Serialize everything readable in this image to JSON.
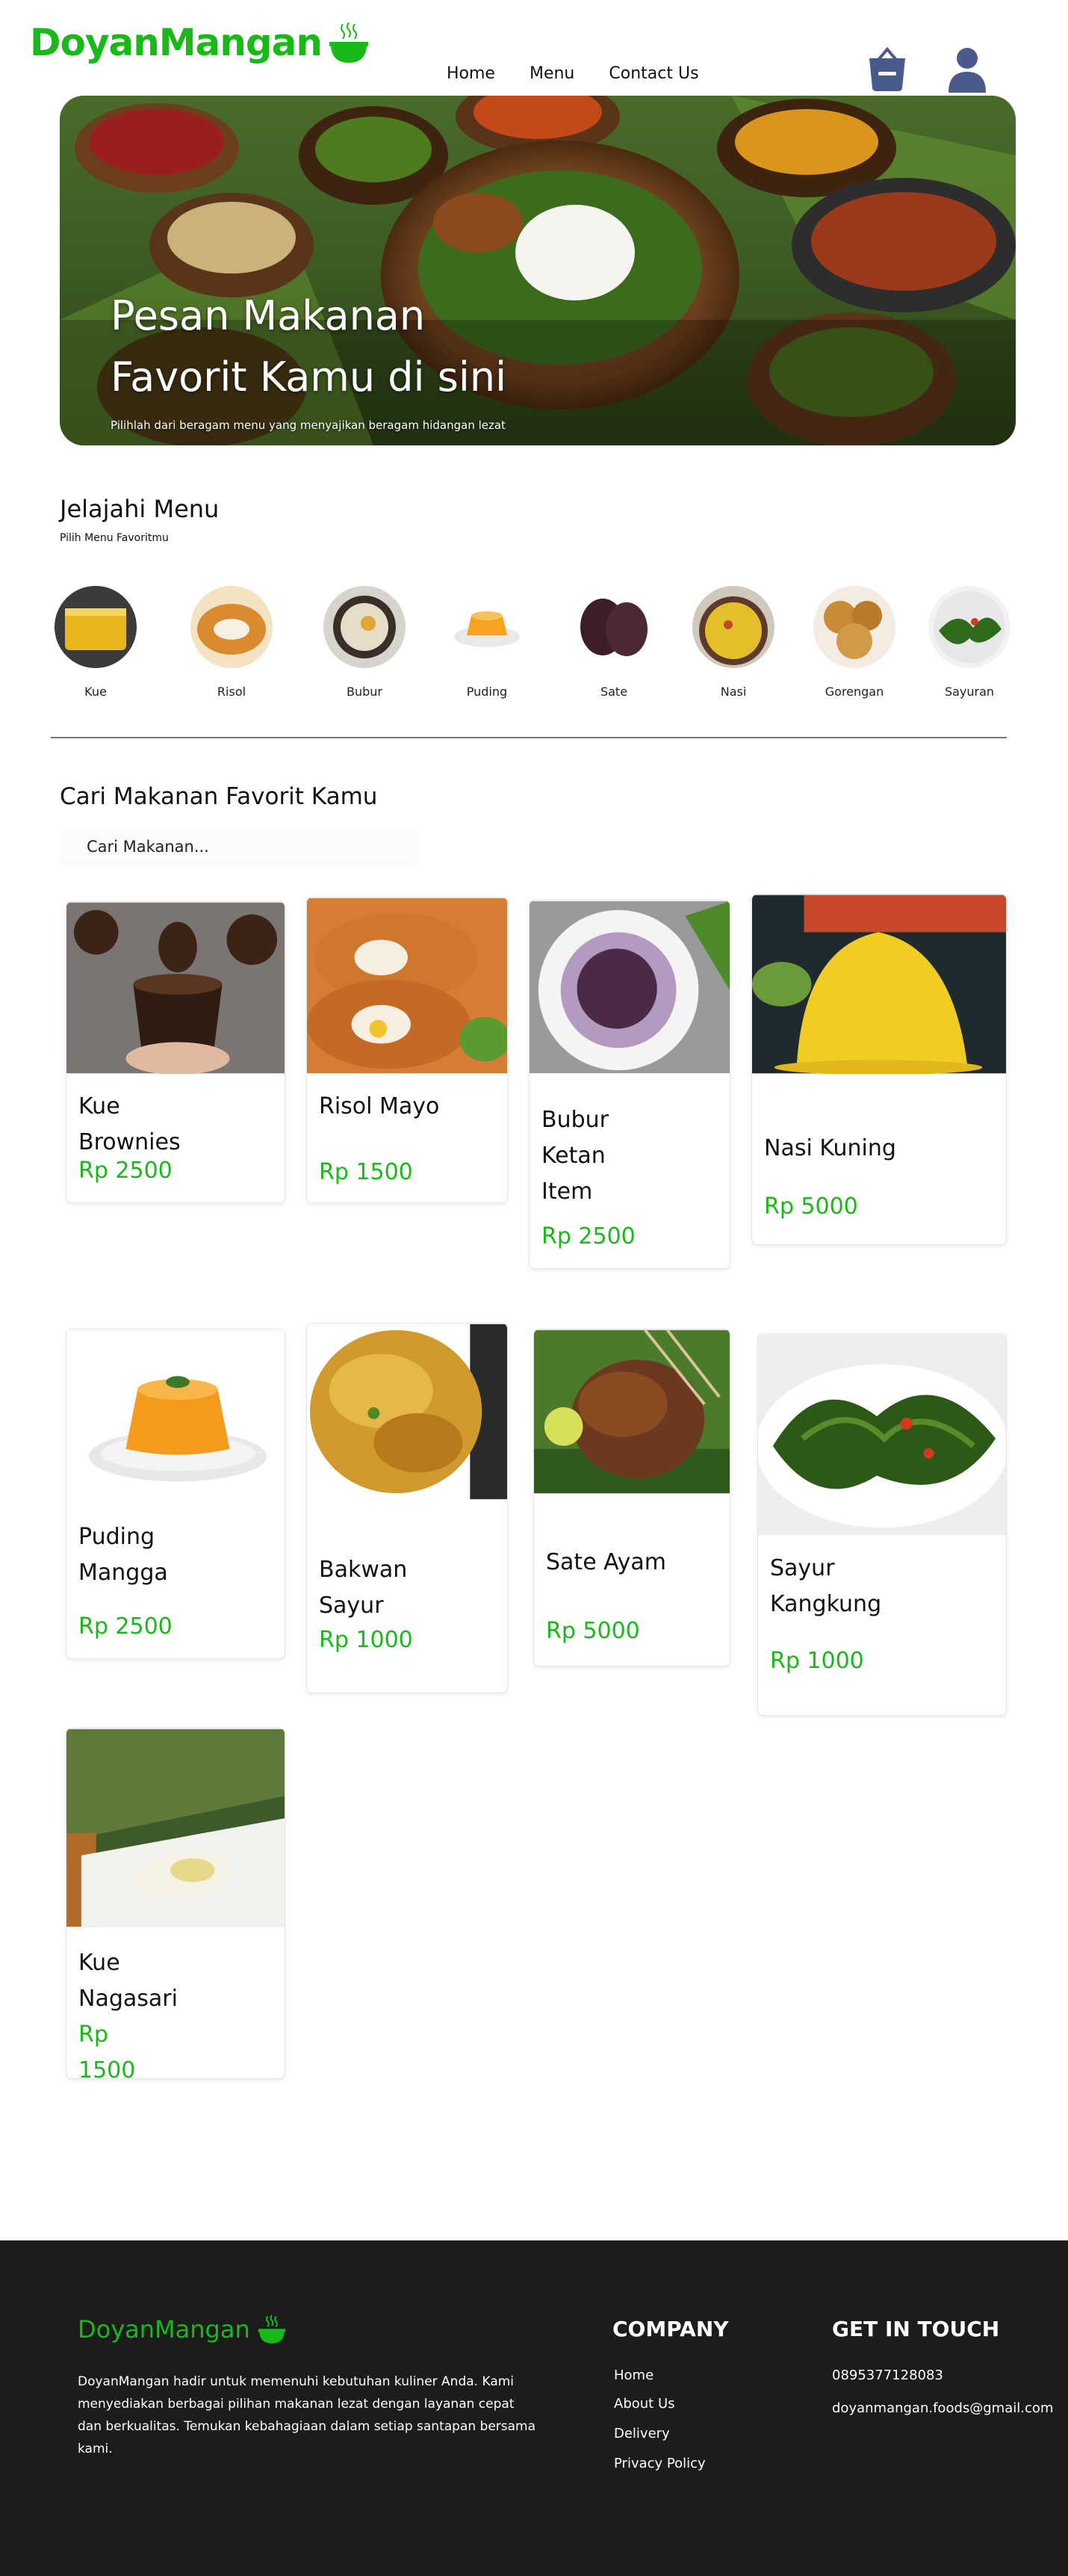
{
  "header": {
    "logo": "DoyanMangan",
    "nav": [
      "Home",
      "Menu",
      "Contact Us"
    ]
  },
  "hero": {
    "title_line1": "Pesan Makanan",
    "title_line2": "Favorit Kamu di sini",
    "subtitle": "Pilihlah dari beragam menu yang menyajikan beragam hidangan lezat"
  },
  "explore": {
    "title": "Jelajahi Menu",
    "subtitle": "Pilih Menu Favoritmu",
    "categories": [
      "Kue",
      "Risol",
      "Bubur",
      "Puding",
      "Sate",
      "Nasi",
      "Gorengan",
      "Sayuran"
    ]
  },
  "search": {
    "title": "Cari Makanan Favorit Kamu",
    "placeholder": "Cari Makanan..."
  },
  "products": [
    {
      "name_lines": [
        "Kue",
        "Brownies"
      ],
      "price": "Rp 2500"
    },
    {
      "name_lines": [
        "Risol Mayo"
      ],
      "price": "Rp 1500"
    },
    {
      "name_lines": [
        "Bubur",
        "Ketan",
        "Item"
      ],
      "price": "Rp 2500"
    },
    {
      "name_lines": [
        "Nasi Kuning"
      ],
      "price": "Rp 5000"
    },
    {
      "name_lines": [
        "Puding",
        "Mangga"
      ],
      "price": "Rp 2500"
    },
    {
      "name_lines": [
        "Bakwan",
        "Sayur"
      ],
      "price": "Rp 1000"
    },
    {
      "name_lines": [
        "Sate Ayam"
      ],
      "price": "Rp 5000"
    },
    {
      "name_lines": [
        "Sayur",
        "Kangkung"
      ],
      "price": "Rp 1000"
    },
    {
      "name_lines": [
        "Kue",
        "Nagasari"
      ],
      "price_lines": [
        "Rp",
        "1500"
      ]
    }
  ],
  "footer": {
    "logo": "DoyanMangan",
    "description": "DoyanMangan hadir untuk memenuhi kebutuhan kuliner Anda. Kami menyediakan berbagai pilihan makanan lezat dengan layanan cepat dan berkualitas. Temukan kebahagiaan dalam setiap santapan bersama kami.",
    "company_title": "COMPANY",
    "company_links": [
      "Home",
      "About Us",
      "Delivery",
      "Privacy Policy"
    ],
    "contact_title": "GET IN TOUCH",
    "phone": "0895377128083",
    "email": "doyanmangan.foods@gmail.com"
  },
  "colors": {
    "brand_green": "#19b919",
    "icon_navy": "#4a5a8a",
    "footer_bg": "#1c1c1c"
  },
  "icons": [
    "bowl-icon",
    "cart-icon",
    "user-icon"
  ]
}
